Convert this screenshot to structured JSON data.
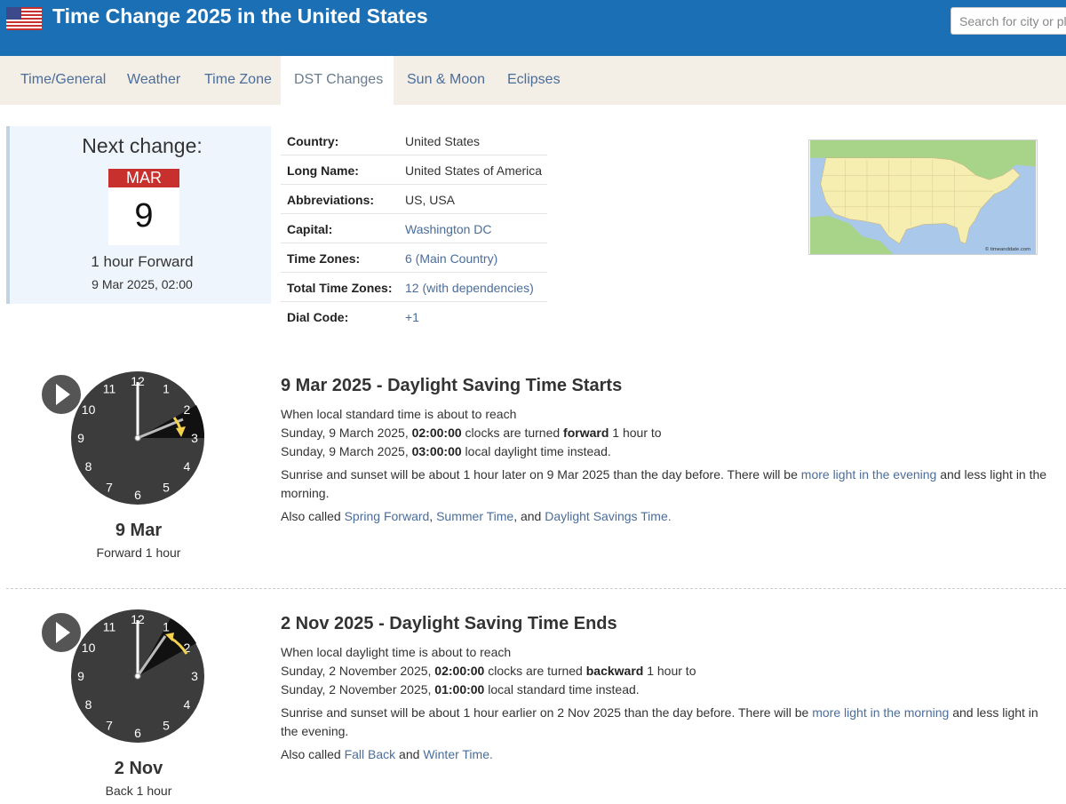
{
  "header": {
    "title": "Time Change 2025 in the United States",
    "search_placeholder": "Search for city or place..."
  },
  "nav": {
    "tabs": [
      {
        "label": "Time/General"
      },
      {
        "label": "Weather"
      },
      {
        "label": "Time Zone"
      },
      {
        "label": "DST Changes",
        "active": true
      },
      {
        "label": "Sun & Moon"
      },
      {
        "label": "Eclipses"
      }
    ]
  },
  "next_change": {
    "title": "Next change:",
    "month": "MAR",
    "day": "9",
    "description": "1 hour Forward",
    "datetime": "9 Mar 2025, 02:00"
  },
  "country_info": {
    "rows": [
      {
        "label": "Country:",
        "value": "United States"
      },
      {
        "label": "Long Name:",
        "value": "United States of America"
      },
      {
        "label": "Abbreviations:",
        "value": "US, USA"
      },
      {
        "label": "Capital:",
        "value": "Washington DC"
      },
      {
        "label": "Time Zones:",
        "value": "6 (Main Country)"
      },
      {
        "label": "Total Time Zones:",
        "value": "12 (with dependencies)"
      },
      {
        "label": "Dial Code:",
        "value": "+1"
      }
    ]
  },
  "map": {
    "credit": "© timeanddate.com"
  },
  "events": [
    {
      "side_date": "9 Mar",
      "side_sub": "Forward 1 hour",
      "title": "9 Mar 2025 - Daylight Saving Time Starts",
      "line1": "When local standard time is about to reach",
      "line2_a": "Sunday, 9 March 2025, ",
      "line2_time": "02:00:00",
      "line2_b": " clocks are turned ",
      "line2_dir": "forward",
      "line2_c": " 1 hour to",
      "line3_a": "Sunday, 9 March 2025, ",
      "line3_time": "03:00:00",
      "line3_b": " local daylight time instead.",
      "sun_a": "Sunrise and sunset will be about 1 hour later on 9 Mar 2025 than the day before. There will be ",
      "sun_link": "more light in the evening",
      "sun_b": " and less light in the morning.",
      "aka_prefix": "Also called ",
      "aka_1": "Spring Forward",
      "aka_sep1": ", ",
      "aka_2": "Summer Time",
      "aka_sep2": ", and ",
      "aka_3": "Daylight Savings Time",
      "aka_end": "."
    },
    {
      "side_date": "2 Nov",
      "side_sub": "Back 1 hour",
      "title": "2 Nov 2025 - Daylight Saving Time Ends",
      "line1": "When local daylight time is about to reach",
      "line2_a": "Sunday, 2 November 2025, ",
      "line2_time": "02:00:00",
      "line2_b": " clocks are turned ",
      "line2_dir": "backward",
      "line2_c": " 1 hour to",
      "line3_a": "Sunday, 2 November 2025, ",
      "line3_time": "01:00:00",
      "line3_b": " local standard time instead.",
      "sun_a": "Sunrise and sunset will be about 1 hour earlier on 2 Nov 2025 than the day before. There will be ",
      "sun_link": "more light in the morning",
      "sun_b": " and less light in the evening.",
      "aka_prefix": "Also called ",
      "aka_1": "Fall Back",
      "aka_sep1": " and ",
      "aka_2": "Winter Time",
      "aka_end": "."
    }
  ],
  "clock_numbers": [
    "12",
    "1",
    "2",
    "3",
    "4",
    "5",
    "6",
    "7",
    "8",
    "9",
    "10",
    "11"
  ],
  "colors": {
    "header_bg": "#1b6fb4",
    "nav_bg": "#f4efe6",
    "link": "#4a6d9c",
    "calendar_red": "#c8302e",
    "clock_face": "#3c3c3c",
    "arrow_yellow": "#f4d24c"
  }
}
